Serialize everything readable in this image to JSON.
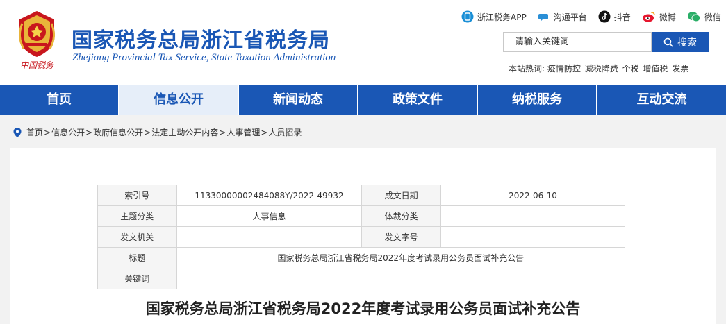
{
  "header": {
    "title": "国家税务总局浙江省税务局",
    "subtitle": "Zhejiang Provincial Tax Service, State Taxation Administration",
    "emblem_text": "中国税务"
  },
  "social": [
    {
      "label": "浙江税务APP",
      "icon": "app-icon",
      "color": "#1a8fd6"
    },
    {
      "label": "沟通平台",
      "icon": "chat-bubble-icon",
      "color": "#2a8fd6"
    },
    {
      "label": "抖音",
      "icon": "douyin-icon",
      "color": "#111111"
    },
    {
      "label": "微博",
      "icon": "weibo-icon",
      "color": "#e6162d"
    },
    {
      "label": "微信",
      "icon": "wechat-icon",
      "color": "#2aae67"
    }
  ],
  "search": {
    "placeholder": "请输入关键词",
    "button_label": "搜索"
  },
  "hotwords": {
    "label": "本站热词:",
    "items": [
      "疫情防控",
      "减税降费",
      "个税",
      "增值税",
      "发票"
    ]
  },
  "nav": [
    {
      "label": "首页"
    },
    {
      "label": "信息公开",
      "active": true
    },
    {
      "label": "新闻动态"
    },
    {
      "label": "政策文件"
    },
    {
      "label": "纳税服务"
    },
    {
      "label": "互动交流"
    }
  ],
  "breadcrumb": [
    "首页",
    "信息公开",
    "政府信息公开",
    "法定主动公开内容",
    "人事管理",
    "人员招录"
  ],
  "meta": {
    "index_label": "索引号",
    "index_value": "11330000002484088Y/2022-49932",
    "date_label": "成文日期",
    "date_value": "2022-06-10",
    "topic_label": "主题分类",
    "topic_value": "人事信息",
    "genre_label": "体裁分类",
    "genre_value": "",
    "issuer_label": "发文机关",
    "issuer_value": "",
    "docno_label": "发文字号",
    "docno_value": "",
    "title_label": "标题",
    "title_value": "国家税务总局浙江省税务局2022年度考试录用公务员面试补充公告",
    "keywords_label": "关键词",
    "keywords_value": ""
  },
  "article": {
    "title": "国家税务总局浙江省税务局2022年度考试录用公务员面试补充公告"
  },
  "colors": {
    "brand_blue": "#1a57b5",
    "emblem_red": "#c8161d"
  }
}
